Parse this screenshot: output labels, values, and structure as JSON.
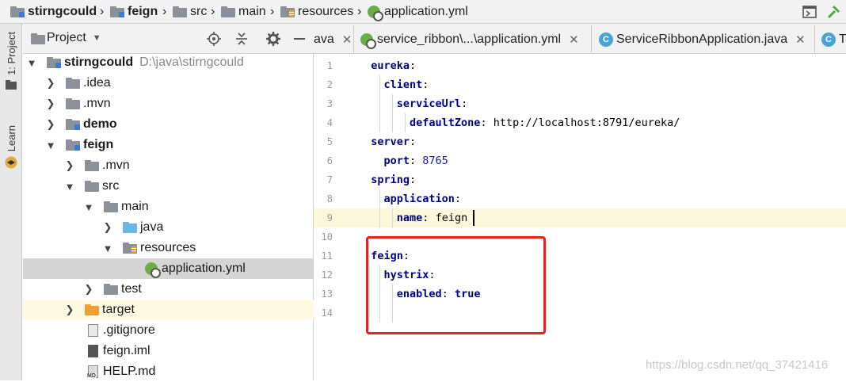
{
  "breadcrumb": {
    "items": [
      "stirngcould",
      "feign",
      "src",
      "main",
      "resources",
      "application.yml"
    ]
  },
  "toolstripe": {
    "project_tab": "1: Project",
    "learn_tab": "Learn"
  },
  "project_panel": {
    "title": "Project",
    "tree": [
      {
        "label": "stirngcould",
        "hint": "D:\\java\\stirngcould",
        "bold": true
      },
      {
        "label": ".idea"
      },
      {
        "label": ".mvn"
      },
      {
        "label": "demo",
        "bold": true
      },
      {
        "label": "feign",
        "bold": true
      },
      {
        "label": ".mvn"
      },
      {
        "label": "src"
      },
      {
        "label": "main"
      },
      {
        "label": "java"
      },
      {
        "label": "resources"
      },
      {
        "label": "application.yml"
      },
      {
        "label": "test"
      },
      {
        "label": "target"
      },
      {
        "label": ".gitignore"
      },
      {
        "label": "feign.iml"
      },
      {
        "label": "HELP.md"
      }
    ]
  },
  "editor": {
    "tabs": [
      {
        "label": "ava"
      },
      {
        "label": "service_ribbon\\...\\application.yml"
      },
      {
        "label": "ServiceRibbonApplication.java"
      },
      {
        "label": "T"
      }
    ],
    "line_numbers": [
      "1",
      "2",
      "3",
      "4",
      "5",
      "6",
      "7",
      "8",
      "9",
      "10",
      "11",
      "12",
      "13",
      "14"
    ],
    "lines": [
      {
        "key": "eureka",
        "sep": ":",
        "value": ""
      },
      {
        "key": "client",
        "sep": ":",
        "value": ""
      },
      {
        "key": "serviceUrl",
        "sep": ":",
        "value": ""
      },
      {
        "key": "defaultZone",
        "sep": ":",
        "value": " http://localhost:8791/eureka/"
      },
      {
        "key": "server",
        "sep": ":",
        "value": ""
      },
      {
        "key": "port",
        "sep": ":",
        "value": " 8765"
      },
      {
        "key": "spring",
        "sep": ":",
        "value": ""
      },
      {
        "key": "application",
        "sep": ":",
        "value": ""
      },
      {
        "key": "name",
        "sep": ":",
        "value": " feign"
      },
      {
        "key": "",
        "sep": "",
        "value": ""
      },
      {
        "key": "feign",
        "sep": ":",
        "value": ""
      },
      {
        "key": "hystrix",
        "sep": ":",
        "value": ""
      },
      {
        "key": "enabled",
        "sep": ":",
        "value": " true"
      },
      {
        "key": "",
        "sep": "",
        "value": ""
      }
    ]
  },
  "watermark": "https://blog.csdn.net/qq_37421416",
  "colors": {
    "annotation_box": "#e8231d",
    "yaml_key": "#000080",
    "yaml_number": "#1a1aa6"
  }
}
